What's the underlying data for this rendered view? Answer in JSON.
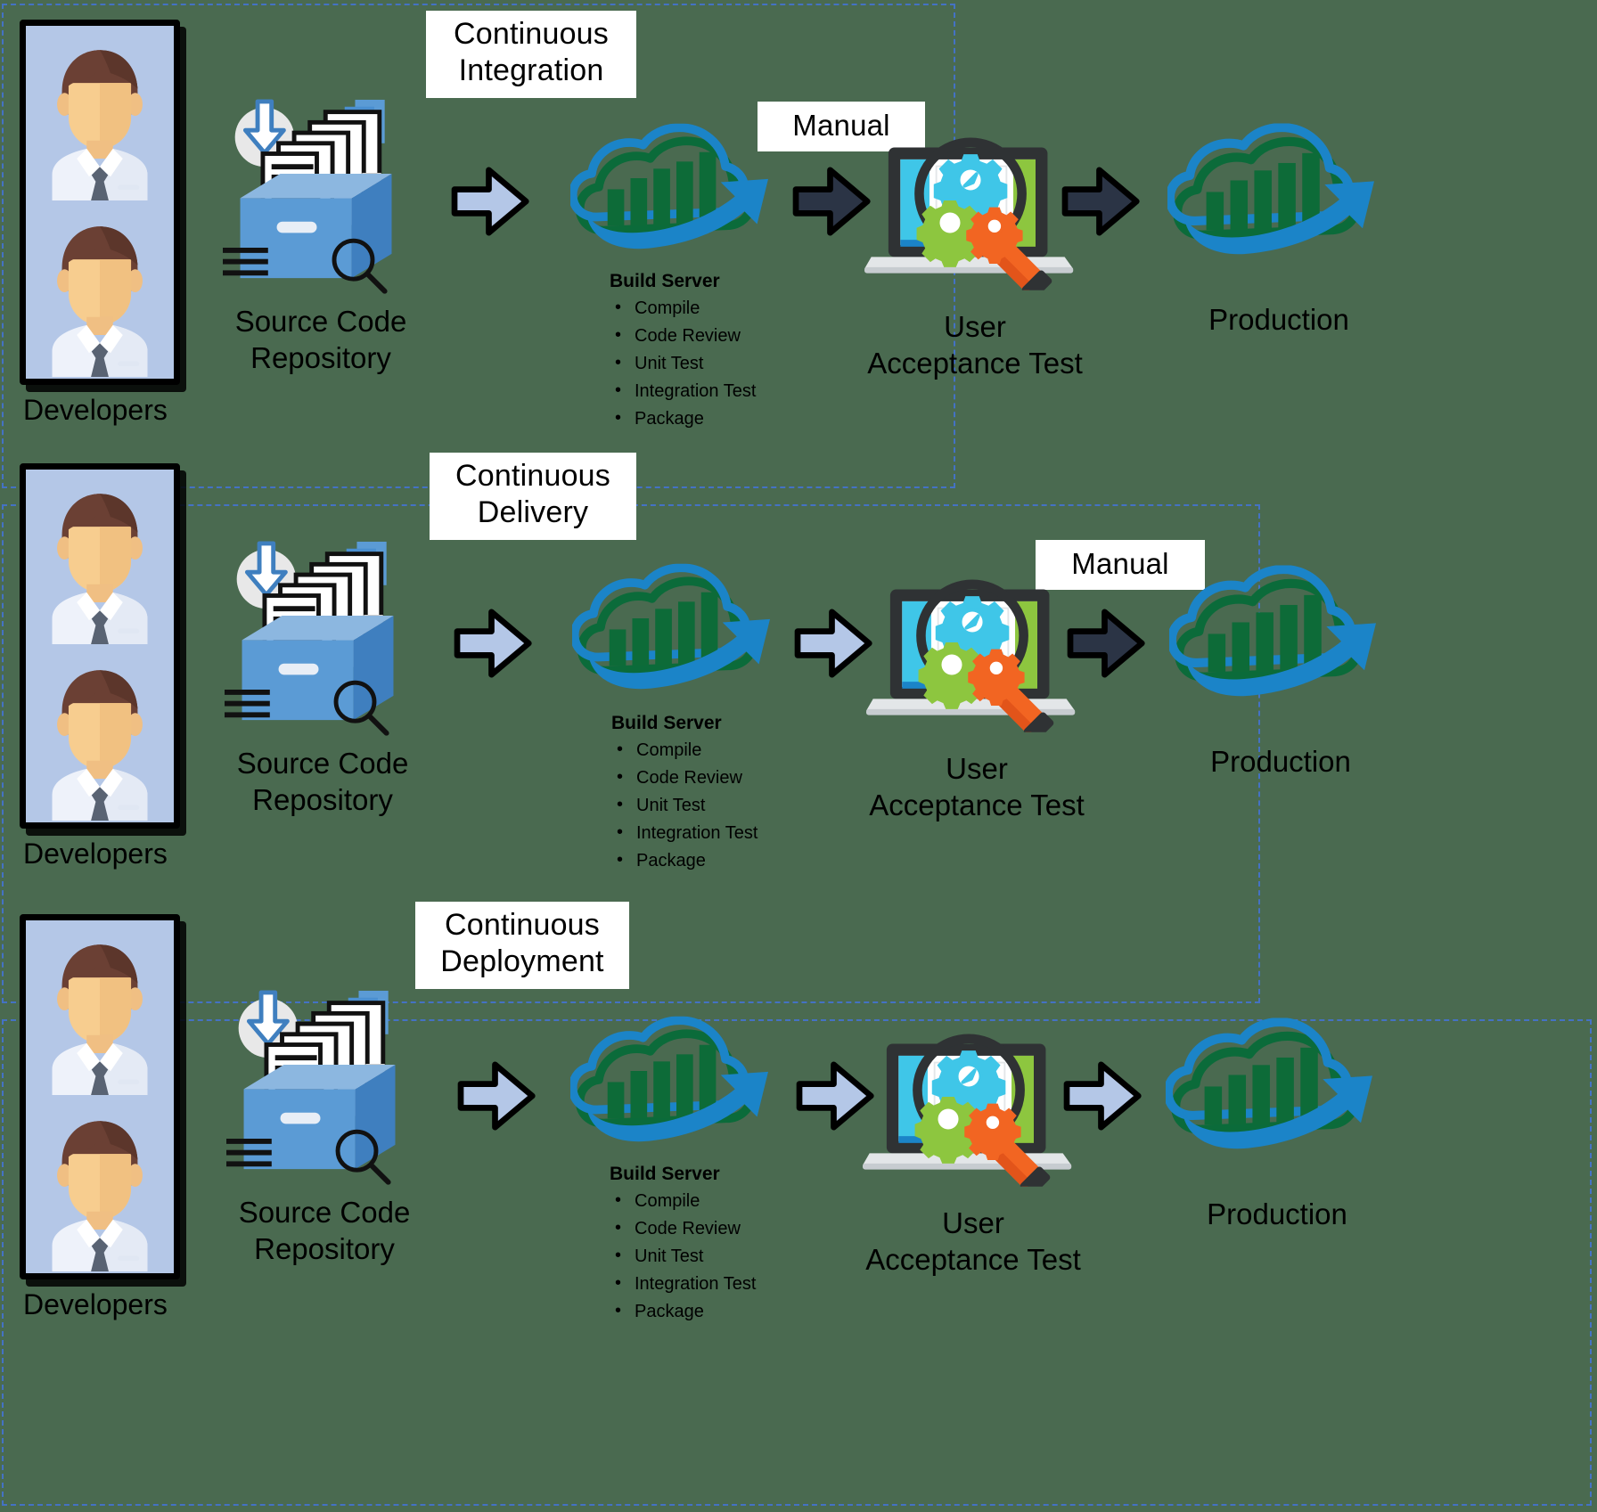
{
  "diagram": {
    "title": "DevOps pipeline: Continuous Integration, Delivery and Deployment",
    "background_color": "#4a6a50",
    "dashed_border_color": "#4472C4"
  },
  "rows": [
    {
      "phase_label": "Continuous\nIntegration",
      "developers_caption": "Developers",
      "repository_label": "Source Code\nRepository",
      "build_server": {
        "title": "Build Server",
        "items": [
          "Compile",
          "Code Review",
          "Unit Test",
          "Integration Test",
          "Package"
        ]
      },
      "uat_label": "User\nAcceptance Test",
      "production_label": "Production",
      "manual_label": "Manual",
      "arrows": [
        "auto",
        "manual",
        "manual"
      ]
    },
    {
      "phase_label": "Continuous\nDelivery",
      "developers_caption": "Developers",
      "repository_label": "Source Code\nRepository",
      "build_server": {
        "title": "Build Server",
        "items": [
          "Compile",
          "Code Review",
          "Unit Test",
          "Integration Test",
          "Package"
        ]
      },
      "uat_label": "User\nAcceptance Test",
      "production_label": "Production",
      "manual_label": "Manual",
      "arrows": [
        "auto",
        "auto",
        "manual"
      ]
    },
    {
      "phase_label": "Continuous\nDeployment",
      "developers_caption": "Developers",
      "repository_label": "Source Code\nRepository",
      "build_server": {
        "title": "Build Server",
        "items": [
          "Compile",
          "Code Review",
          "Unit Test",
          "Integration Test",
          "Package"
        ]
      },
      "uat_label": "User\nAcceptance Test",
      "production_label": "Production",
      "manual_label": "",
      "arrows": [
        "auto",
        "auto",
        "auto"
      ]
    }
  ],
  "icons": {
    "developer": "developer-avatar-icon",
    "repository": "source-code-repository-icon",
    "build_server": "cloud-build-server-icon",
    "uat": "laptop-magnifier-gears-icon",
    "production": "cloud-production-icon",
    "arrow_auto": "light-blue-arrow-icon",
    "arrow_manual": "dark-arrow-icon"
  },
  "colors": {
    "arrow_auto_fill": "#b4c7e7",
    "arrow_manual_fill": "#2b3445",
    "cloud_blue": "#1b84c8",
    "cloud_green": "#0b6b3a",
    "bar_green": "#0d6b38",
    "repo_blue": "#5b9bd5",
    "gear_cyan": "#3fc6e8",
    "gear_green": "#8dc63f",
    "gear_orange": "#f26522",
    "laptop_dark": "#2f3234",
    "avatar_bg": "#b4c7e7",
    "hair_brown": "#6b4034",
    "skin": "#f5c98c",
    "shirt": "#eef2fa",
    "tie": "#596373"
  }
}
